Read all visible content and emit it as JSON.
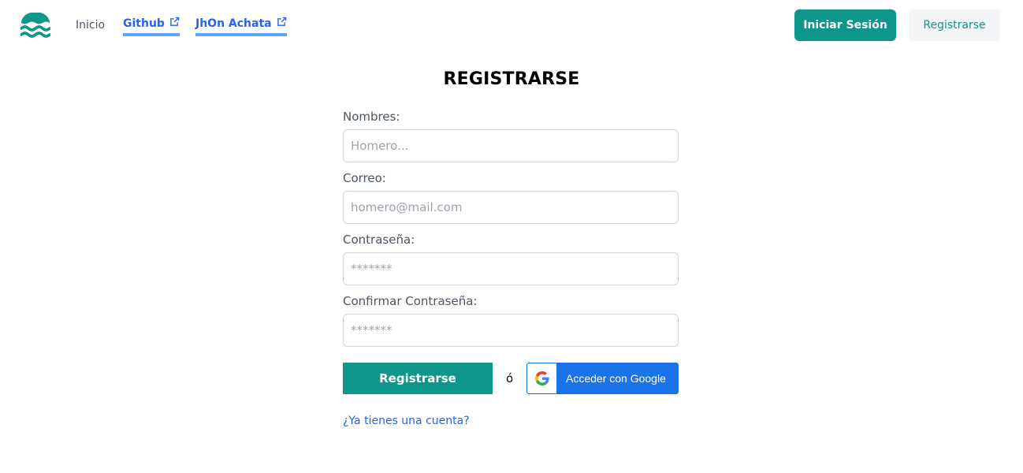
{
  "navbar": {
    "logo_icon": "waves-logo-icon",
    "home_label": "Inicio",
    "github_label": "Github",
    "author_label": "JhOn Achata",
    "external_icon": "external-link-icon",
    "login_button": "Iniciar Sesión",
    "register_button": "Registrarse"
  },
  "form": {
    "title": "REGISTRARSE",
    "fields": [
      {
        "label": "Nombres:",
        "placeholder": "Homero...",
        "value": ""
      },
      {
        "label": "Correo:",
        "placeholder": "homero@mail.com",
        "value": ""
      },
      {
        "label": "Contraseña:",
        "placeholder": "*******",
        "value": ""
      },
      {
        "label": "Confirmar Contraseña:",
        "placeholder": "*******",
        "value": ""
      }
    ],
    "submit_button": "Registrarse",
    "or_text": "ó",
    "google_button": "Acceder con Google",
    "google_icon": "google-icon",
    "account_link": "¿Ya tienes una cuenta?"
  },
  "colors": {
    "primary": "#0f968a",
    "link": "#2563eb",
    "link_underline": "#60a5fa",
    "google_blue": "#1a73e8",
    "secondary_button_bg": "#f3f4f6"
  }
}
